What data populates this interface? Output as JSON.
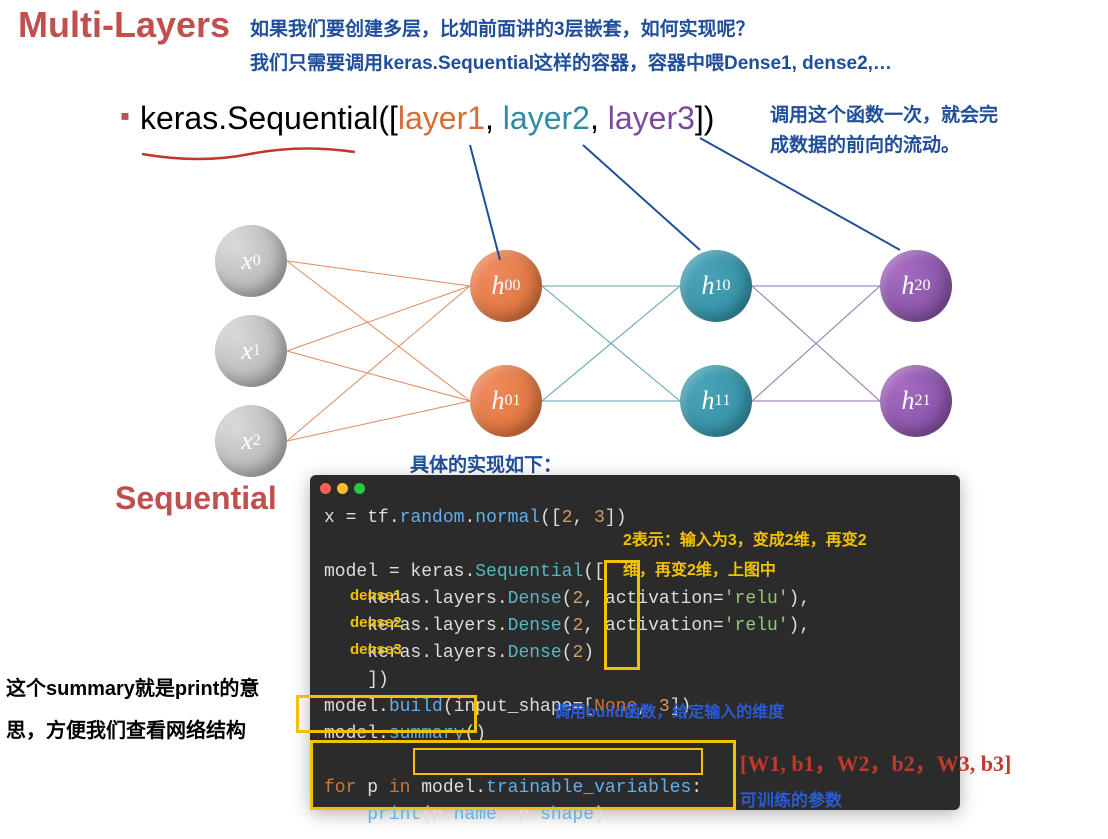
{
  "title": "Multi-Layers",
  "anno1": "如果我们要创建多层，比如前面讲的3层嵌套，如何实现呢？",
  "anno2": "我们只需要调用keras.Sequential这样的容器，容器中喂Dense1, dense2,…",
  "api": {
    "prefix": "keras.Sequential([",
    "l1": "layer1",
    "sep": ", ",
    "l2": "layer2",
    "l3": "layer3",
    "suffix": "])"
  },
  "anno3a": "调用这个函数一次，就会完",
  "anno3b": "成数据的前向的流动。",
  "nodes": {
    "x0": "x",
    "x0sub": "0",
    "x1": "x",
    "x1sub": "1",
    "x2": "x",
    "x2sub": "2",
    "h00": "h",
    "h00sub0": "0",
    "h00sup": "0",
    "h10": "h",
    "h10sub": "1",
    "h10sup": "0",
    "h01": "h",
    "h01sub": "0",
    "h01sup": "1",
    "h11": "h",
    "h11sub": "1",
    "h11sup": "1",
    "h02": "h",
    "h02sub": "0",
    "h02sup": "2",
    "h12": "h",
    "h12sub": "1",
    "h12sup": "2"
  },
  "implLabel": "具体的实现如下：",
  "seqTitle": "Sequential",
  "code": {
    "l1a": "x ",
    "l1b": "=",
    "l1c": " tf",
    "l1d": ".",
    "l1e": "random",
    "l1f": ".",
    "l1g": "normal",
    "l1h": "([",
    "l1i": "2",
    "l1j": ", ",
    "l1k": "3",
    "l1l": "])",
    "l3a": "model ",
    "l3b": "=",
    "l3c": " keras",
    "l3d": ".",
    "l3e": "Sequential",
    "l3f": "([",
    "l4a": "    keras",
    "l4b": ".",
    "l4c": "layers",
    "l4d": ".",
    "l4e": "Dense",
    "l4f": "(",
    "l4g": "2",
    "l4h": ", activation=",
    "l4i": "'relu'",
    "l4j": "),",
    "l5a": "    keras",
    "l5b": ".",
    "l5c": "layers",
    "l5d": ".",
    "l5e": "Dense",
    "l5f": "(",
    "l5g": "2",
    "l5h": ", activation=",
    "l5i": "'relu'",
    "l5j": "),",
    "l6a": "    keras",
    "l6b": ".",
    "l6c": "layers",
    "l6d": ".",
    "l6e": "Dense",
    "l6f": "(",
    "l6g": "2",
    "l6h": ")",
    "l7a": "    ])",
    "l8a": "model",
    "l8b": ".",
    "l8c": "build",
    "l8d": "(input_shape=[",
    "l8e": "None",
    "l8f": ", ",
    "l8g": "3",
    "l8h": "])",
    "l9a": "model",
    "l9b": ".",
    "l9c": "summary",
    "l9d": "()",
    "l11a": "for",
    "l11b": " p ",
    "l11c": "in",
    "l11d": " model",
    "l11e": ".",
    "l11f": "trainable_variables",
    "l11g": ":",
    "l12a": "    ",
    "l12b": "print",
    "l12c": "(p",
    "l12d": ".",
    "l12e": "name",
    "l12f": ", p",
    "l12g": ".",
    "l12h": "shape",
    "l12i": ")"
  },
  "denseLabels": {
    "d1": "dense1",
    "d2": "dense2",
    "d3": "dense3"
  },
  "leftText1": "这个summary就是print的意",
  "leftText2": "思，方便我们查看网络结构",
  "annoYellow1": "2表示：输入为3，变成2维，再变2",
  "annoYellow2": "维，再变2维，上图中",
  "annoBuild": "调用build函数，给定输入的维度",
  "handwritten": "[W1, b1，W2，b2，W3, b3]",
  "trainableLabel": "可训练的参数"
}
